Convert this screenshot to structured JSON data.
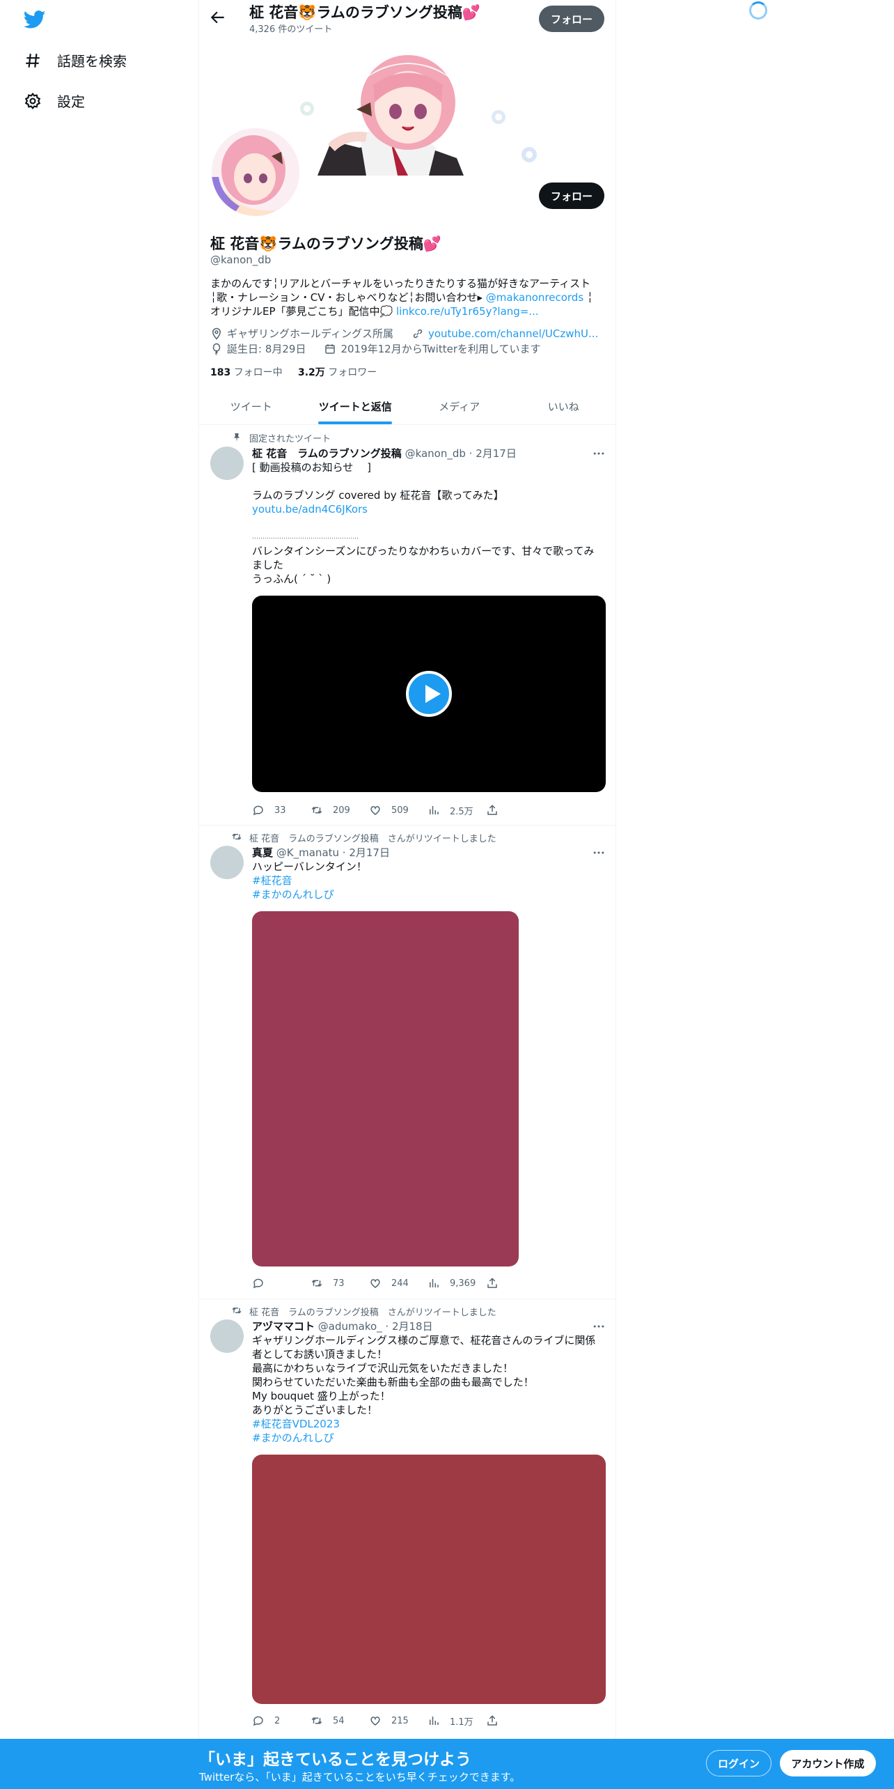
{
  "nav": {
    "items": [
      {
        "label": "話題を検索",
        "icon": "hashtag-icon"
      },
      {
        "label": "設定",
        "icon": "gear-icon"
      }
    ]
  },
  "header": {
    "title": "柾 花音🐯ラムのラブソング投稿💕",
    "tweet_count": "4,326 件のツイート",
    "follow_label": "フォロー"
  },
  "profile": {
    "name": "柾 花音🐯ラムのラブソング投稿💕",
    "handle": "@kanon_db",
    "follow_label": "フォロー",
    "bio": {
      "line1": "まかのんです╎リアルとバーチャルをいったりきたりする猫が好きなアーティスト",
      "line2a": "╎歌・ナレーション・CV・おしゃべりなど╎お問い合わせ▸ ",
      "line2_link": "@makanonrecords",
      "line2b": " ╎",
      "line3a": "オリジナルEP「夢見ごこち」配信中💭 ",
      "line3_link": "linkco.re/uTy1r65y?lang=..."
    },
    "location": "ギャザリングホールディングス所属",
    "website": "youtube.com/channel/UCzwhU...",
    "birthday": "誕生日: 8月29日",
    "joined": "2019年12月からTwitterを利用しています",
    "following_count": "183",
    "following_label": "フォロー中",
    "followers_count": "3.2万",
    "followers_label": "フォロワー"
  },
  "tabs": [
    {
      "label": "ツイート",
      "active": false
    },
    {
      "label": "ツイートと返信",
      "active": true
    },
    {
      "label": "メディア",
      "active": false
    },
    {
      "label": "いいね",
      "active": false
    }
  ],
  "tweets": [
    {
      "social": "固定されたツイート",
      "name": "柾 花音　ラムのラブソング投稿",
      "handle_date": "@kanon_db · 2月17日",
      "lines": [
        "[ 動画投稿のお知らせ　 ]",
        "",
        "ラムのラブソング covered by 柾花音【歌ってみた】",
        "youtu.be/adn4C6JKors",
        "",
        "……………………………………………",
        "バレンタインシーズンにぴったりなかわちぃカバーです、甘々で歌ってみ",
        "ました",
        "うっふん( ´ ˘ ` )"
      ],
      "reply": "33",
      "retweet": "209",
      "like": "509",
      "views": "2.5万"
    },
    {
      "social": "柾 花音　ラムのラブソング投稿　さんがリツイートしました",
      "name": "真夏",
      "handle_date": "@K_manatu · 2月17日",
      "lines": [
        "ハッピーバレンタイン！",
        "#柾花音",
        "#まかのんれしぴ"
      ],
      "reply": "",
      "retweet": "73",
      "like": "244",
      "views": "9,369",
      "media_color": "#9b3a55"
    },
    {
      "social": "柾 花音　ラムのラブソング投稿　さんがリツイートしました",
      "name": "アヅママコト",
      "handle_date": "@adumako_ · 2月18日",
      "lines": [
        "ギャザリングホールディングス様のご厚意で、柾花音さんのライブに関係",
        "者としてお誘い頂きました！",
        "最高にかわちぃなライブで沢山元気をいただきました！",
        "関わらせていただいた楽曲も新曲も全部の曲も最高でした！",
        "My bouquet 盛り上がった！",
        "ありがとうございました！",
        "#柾花音VDL2023",
        "#まかのんれしぴ"
      ],
      "reply": "2",
      "retweet": "54",
      "like": "215",
      "views": "1.1万",
      "media_color": "#9e3a44"
    }
  ],
  "bottom": {
    "headline": "「いま」起きていることを見つけよう",
    "sub": "Twitterなら、「いま」起きていることをいち早くチェックできます。",
    "login": "ログイン",
    "signup": "アカウント作成"
  },
  "colors": {
    "accent": "#1d9bf0",
    "text": "#0f1419",
    "muted": "#536471"
  }
}
